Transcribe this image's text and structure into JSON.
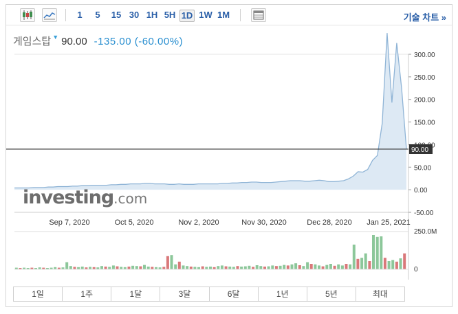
{
  "toolbar": {
    "candle_icon": "candlestick-chart-icon",
    "area_icon": "area-chart-icon",
    "timeframes": [
      "1",
      "5",
      "15",
      "30",
      "1H",
      "5H",
      "1D",
      "1W",
      "1M"
    ],
    "active_timeframe": "1D",
    "table_icon": "table-icon",
    "advanced_label": "기술 차트 »"
  },
  "quote": {
    "name": "게임스탑",
    "price": "90.00",
    "change": "-135.00",
    "change_pct": "(-60.00%)"
  },
  "watermark": {
    "main": "investing",
    "suffix": ".com"
  },
  "colors": {
    "line": "#8fb4d6",
    "area": "#dde9f4",
    "up_volume": "#8cc79a",
    "down_volume": "#d9787a",
    "accent": "#2a5fa8"
  },
  "chart_data": {
    "type": "area",
    "y_ticks": [
      "300.00",
      "250.00",
      "200.00",
      "150.00",
      "100.00",
      "50.00",
      "0.00",
      "-50.00"
    ],
    "x_ticks": [
      "Sep 7, 2020",
      "Oct 5, 2020",
      "Nov 2, 2020",
      "Nov 30, 2020",
      "Dec 28, 2020",
      "Jan 25, 2021"
    ],
    "ylim": [
      -50,
      300
    ],
    "current_price_label": "90.00",
    "current_price": 90,
    "series": [
      {
        "values": [
          4,
          4,
          4,
          4,
          5,
          5,
          5,
          6,
          6,
          7,
          7,
          7,
          8,
          8,
          9,
          9,
          10,
          10,
          10,
          10,
          11,
          11,
          12,
          12,
          13,
          13,
          13,
          14,
          14,
          13,
          13,
          13,
          12,
          12,
          13,
          12,
          12,
          12,
          13,
          13,
          13,
          13,
          13,
          14,
          14,
          15,
          15,
          16,
          16,
          17,
          17,
          16,
          16,
          16,
          17,
          18,
          19,
          20,
          20,
          20,
          19,
          19,
          20,
          21,
          20,
          18,
          18,
          19,
          20,
          24,
          30,
          40,
          39,
          45,
          65,
          76,
          147,
          347,
          193,
          325,
          225,
          90
        ]
      }
    ],
    "volume": {
      "axis_labels": [
        "250.0M",
        "0"
      ],
      "bars": [
        {
          "v": 6,
          "up": true
        },
        {
          "v": 5,
          "up": false
        },
        {
          "v": 6,
          "up": true
        },
        {
          "v": 5,
          "up": true
        },
        {
          "v": 6,
          "up": false
        },
        {
          "v": 5,
          "up": true
        },
        {
          "v": 7,
          "up": true
        },
        {
          "v": 6,
          "up": false
        },
        {
          "v": 5,
          "up": true
        },
        {
          "v": 6,
          "up": true
        },
        {
          "v": 8,
          "up": true
        },
        {
          "v": 6,
          "up": false
        },
        {
          "v": 7,
          "up": true
        },
        {
          "v": 26,
          "up": true
        },
        {
          "v": 12,
          "up": true
        },
        {
          "v": 9,
          "up": false
        },
        {
          "v": 8,
          "up": true
        },
        {
          "v": 10,
          "up": true
        },
        {
          "v": 7,
          "up": false
        },
        {
          "v": 9,
          "up": true
        },
        {
          "v": 8,
          "up": false
        },
        {
          "v": 7,
          "up": true
        },
        {
          "v": 12,
          "up": true
        },
        {
          "v": 10,
          "up": false
        },
        {
          "v": 9,
          "up": true
        },
        {
          "v": 14,
          "up": true
        },
        {
          "v": 11,
          "up": false
        },
        {
          "v": 9,
          "up": true
        },
        {
          "v": 8,
          "up": true
        },
        {
          "v": 10,
          "up": false
        },
        {
          "v": 13,
          "up": true
        },
        {
          "v": 12,
          "up": true
        },
        {
          "v": 11,
          "up": false
        },
        {
          "v": 16,
          "up": true
        },
        {
          "v": 10,
          "up": true
        },
        {
          "v": 9,
          "up": false
        },
        {
          "v": 8,
          "up": true
        },
        {
          "v": 7,
          "up": true
        },
        {
          "v": 9,
          "up": false
        },
        {
          "v": 48,
          "up": false
        },
        {
          "v": 52,
          "up": true
        },
        {
          "v": 18,
          "up": true
        },
        {
          "v": 28,
          "up": false
        },
        {
          "v": 14,
          "up": true
        },
        {
          "v": 12,
          "up": true
        },
        {
          "v": 10,
          "up": false
        },
        {
          "v": 9,
          "up": true
        },
        {
          "v": 8,
          "up": true
        },
        {
          "v": 11,
          "up": false
        },
        {
          "v": 9,
          "up": true
        },
        {
          "v": 10,
          "up": true
        },
        {
          "v": 8,
          "up": false
        },
        {
          "v": 12,
          "up": true
        },
        {
          "v": 14,
          "up": true
        },
        {
          "v": 11,
          "up": false
        },
        {
          "v": 10,
          "up": true
        },
        {
          "v": 9,
          "up": true
        },
        {
          "v": 12,
          "up": false
        },
        {
          "v": 10,
          "up": true
        },
        {
          "v": 11,
          "up": true
        },
        {
          "v": 13,
          "up": true
        },
        {
          "v": 9,
          "up": false
        },
        {
          "v": 15,
          "up": true
        },
        {
          "v": 12,
          "up": true
        },
        {
          "v": 10,
          "up": false
        },
        {
          "v": 11,
          "up": true
        },
        {
          "v": 14,
          "up": true
        },
        {
          "v": 12,
          "up": false
        },
        {
          "v": 13,
          "up": true
        },
        {
          "v": 16,
          "up": true
        },
        {
          "v": 14,
          "up": false
        },
        {
          "v": 18,
          "up": true
        },
        {
          "v": 22,
          "up": true
        },
        {
          "v": 15,
          "up": false
        },
        {
          "v": 12,
          "up": true
        },
        {
          "v": 26,
          "up": true
        },
        {
          "v": 20,
          "up": false
        },
        {
          "v": 18,
          "up": true
        },
        {
          "v": 14,
          "up": true
        },
        {
          "v": 11,
          "up": false
        },
        {
          "v": 16,
          "up": true
        },
        {
          "v": 20,
          "up": true
        },
        {
          "v": 13,
          "up": false
        },
        {
          "v": 18,
          "up": true
        },
        {
          "v": 14,
          "up": true
        },
        {
          "v": 20,
          "up": false
        },
        {
          "v": 18,
          "up": true
        },
        {
          "v": 90,
          "up": true
        },
        {
          "v": 38,
          "up": false
        },
        {
          "v": 42,
          "up": true
        },
        {
          "v": 58,
          "up": true
        },
        {
          "v": 30,
          "up": false
        },
        {
          "v": 125,
          "up": true
        },
        {
          "v": 118,
          "up": true
        },
        {
          "v": 120,
          "up": true
        },
        {
          "v": 42,
          "up": false
        },
        {
          "v": 30,
          "up": true
        },
        {
          "v": 34,
          "up": true
        },
        {
          "v": 28,
          "up": false
        },
        {
          "v": 40,
          "up": true
        },
        {
          "v": 58,
          "up": false
        }
      ]
    }
  },
  "periods": [
    "1일",
    "1주",
    "1달",
    "3달",
    "6달",
    "1년",
    "5년",
    "최대"
  ]
}
